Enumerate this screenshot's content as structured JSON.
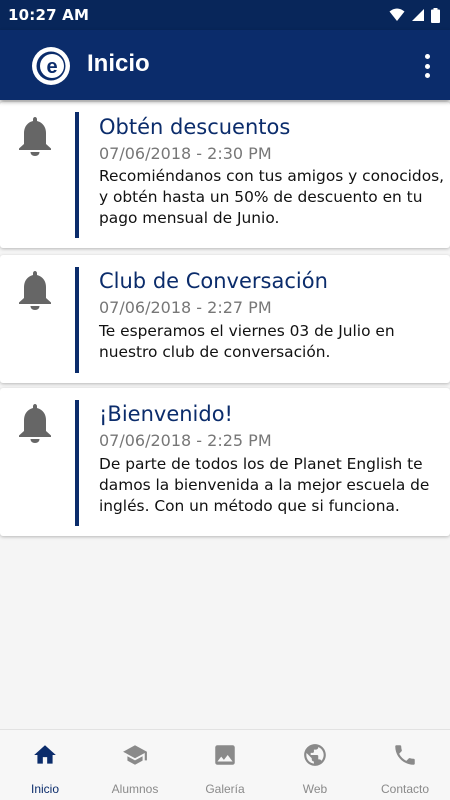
{
  "status_bar": {
    "time": "10:27 AM"
  },
  "app_bar": {
    "title": "Inicio"
  },
  "notifications": [
    {
      "title": "Obtén descuentos",
      "date": "07/06/2018 - 2:30 PM",
      "body": "Recomiéndanos con tus amigos y conocidos, y obtén hasta un 50% de descuento en tu pago mensual de Junio."
    },
    {
      "title": "Club de Conversación",
      "date": "07/06/2018 - 2:27 PM",
      "body": "Te esperamos el viernes 03 de Julio en nuestro club de conversación."
    },
    {
      "title": "¡Bienvenido!",
      "date": "07/06/2018 - 2:25 PM",
      "body": "De parte de todos los de Planet English te damos la bienvenida a la mejor escuela de inglés. Con un método que si funciona."
    }
  ],
  "bottom_nav": [
    {
      "label": "Inicio",
      "icon": "home-icon",
      "active": true
    },
    {
      "label": "Alumnos",
      "icon": "school-icon",
      "active": false
    },
    {
      "label": "Galería",
      "icon": "image-icon",
      "active": false
    },
    {
      "label": "Web",
      "icon": "globe-icon",
      "active": false
    },
    {
      "label": "Contacto",
      "icon": "phone-icon",
      "active": false
    }
  ],
  "colors": {
    "primary": "#0b2c6b",
    "status_bar": "#08265a",
    "inactive": "#8a8a8a"
  }
}
